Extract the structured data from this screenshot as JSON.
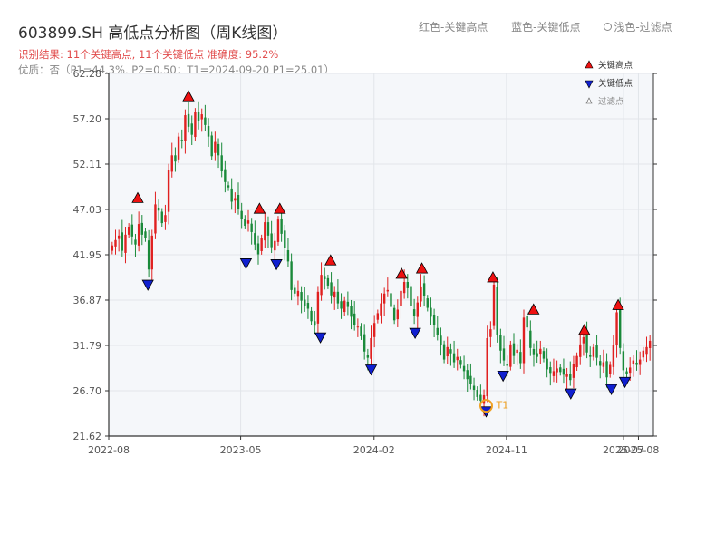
{
  "header": {
    "title": "603899.SH 高低点分析图（周K线图）",
    "result_line": "识别结果: 11个关键高点, 11个关键低点   准确度: 95.2%",
    "quality_line": "优质：否（P1=44.3%, P2=0.50；T1=2024-09-20 P1=25.01）"
  },
  "top_legend": {
    "red_label": "红色-关键高点",
    "blue_label": "蓝色-关键低点",
    "light_label": "浅色-过滤点"
  },
  "colors": {
    "up": "#e02020",
    "down": "#1a8a3a",
    "high": "#ee1111",
    "low": "#1020d0",
    "t1": "#f0a020",
    "plot_bg": "#f5f7fa",
    "grid": "#e2e5ea"
  },
  "chart_data": {
    "type": "candlestick",
    "y_ticks": [
      "62.28",
      "57.20",
      "52.11",
      "47.03",
      "41.95",
      "36.87",
      "31.79",
      "26.70",
      "21.62"
    ],
    "ylim": [
      21.62,
      62.28
    ],
    "x_ticks": [
      "2022-08",
      "2023-05",
      "2024-02",
      "2024-11",
      "2025-07",
      "2025-08"
    ],
    "date_range": [
      "2022-08",
      "2025-08"
    ],
    "legend": [
      "关键高点",
      "关键低点",
      "过滤点"
    ],
    "key_highs": [
      {
        "date": "2022-09-30",
        "price": 47.5
      },
      {
        "date": "2023-01-13",
        "price": 58.9
      },
      {
        "date": "2023-06-09",
        "price": 46.3
      },
      {
        "date": "2023-07-21",
        "price": 46.3
      },
      {
        "date": "2023-11-03",
        "price": 40.5
      },
      {
        "date": "2024-03-29",
        "price": 39.0
      },
      {
        "date": "2024-05-10",
        "price": 39.6
      },
      {
        "date": "2024-10-04",
        "price": 38.6
      },
      {
        "date": "2024-12-27",
        "price": 35.0
      },
      {
        "date": "2025-04-11",
        "price": 32.7
      },
      {
        "date": "2025-06-20",
        "price": 35.5
      }
    ],
    "key_lows": [
      {
        "date": "2022-10-21",
        "price": 39.2
      },
      {
        "date": "2023-05-12",
        "price": 41.6
      },
      {
        "date": "2023-07-14",
        "price": 41.5
      },
      {
        "date": "2023-10-13",
        "price": 33.3
      },
      {
        "date": "2024-01-26",
        "price": 29.7
      },
      {
        "date": "2024-04-26",
        "price": 33.8
      },
      {
        "date": "2024-09-20",
        "price": 25.0
      },
      {
        "date": "2024-10-25",
        "price": 29.0
      },
      {
        "date": "2025-03-14",
        "price": 27.0
      },
      {
        "date": "2025-06-06",
        "price": 27.5
      },
      {
        "date": "2025-07-04",
        "price": 28.3
      }
    ],
    "t1": {
      "label": "T1",
      "date": "2024-09-20",
      "price": 25.01
    },
    "series_close": [
      43.0,
      43.6,
      44.1,
      42.4,
      44.2,
      45.1,
      44.0,
      43.1,
      45.4,
      44.2,
      43.8,
      40.3,
      44.1,
      47.6,
      46.9,
      45.5,
      46.4,
      51.5,
      53.1,
      52.4,
      55.2,
      54.8,
      57.6,
      56.3,
      55.4,
      58.0,
      56.9,
      57.7,
      56.5,
      55.2,
      53.0,
      54.6,
      53.1,
      51.3,
      50.1,
      49.5,
      47.9,
      48.3,
      47.1,
      46.0,
      45.2,
      45.8,
      44.5,
      43.1,
      42.0,
      43.8,
      45.6,
      44.1,
      42.8,
      43.5,
      45.9,
      44.3,
      42.7,
      41.2,
      38.0,
      37.6,
      37.9,
      36.8,
      36.2,
      35.9,
      34.5,
      34.0,
      37.8,
      39.7,
      39.2,
      38.5,
      37.4,
      37.8,
      36.5,
      35.9,
      36.8,
      36.1,
      35.0,
      34.1,
      33.9,
      32.8,
      31.1,
      30.4,
      32.6,
      34.3,
      35.4,
      36.5,
      37.6,
      38.0,
      36.1,
      34.6,
      35.8,
      37.9,
      38.9,
      38.2,
      36.2,
      35.1,
      36.6,
      38.4,
      37.3,
      36.0,
      35.0,
      34.1,
      33.0,
      31.8,
      30.2,
      31.6,
      30.9,
      29.9,
      30.5,
      29.6,
      28.9,
      28.0,
      27.5,
      26.8,
      26.0,
      25.6,
      26.2,
      32.6,
      33.6,
      38.6,
      33.0,
      31.2,
      30.1,
      29.5,
      31.9,
      30.6,
      31.3,
      29.8,
      34.9,
      33.8,
      31.5,
      30.8,
      30.5,
      31.4,
      30.3,
      29.1,
      28.7,
      28.9,
      29.2,
      28.8,
      28.5,
      28.6,
      27.9,
      29.7,
      30.6,
      31.9,
      32.7,
      31.0,
      30.5,
      31.6,
      30.4,
      29.5,
      29.9,
      28.2,
      29.6,
      31.8,
      35.5,
      31.5,
      29.0,
      28.6,
      29.3,
      30.1,
      29.6,
      30.2,
      31.2,
      31.6,
      32.3
    ]
  },
  "legend_labels": {
    "high": "关键高点",
    "low": "关键低点",
    "filtered": "过滤点"
  }
}
